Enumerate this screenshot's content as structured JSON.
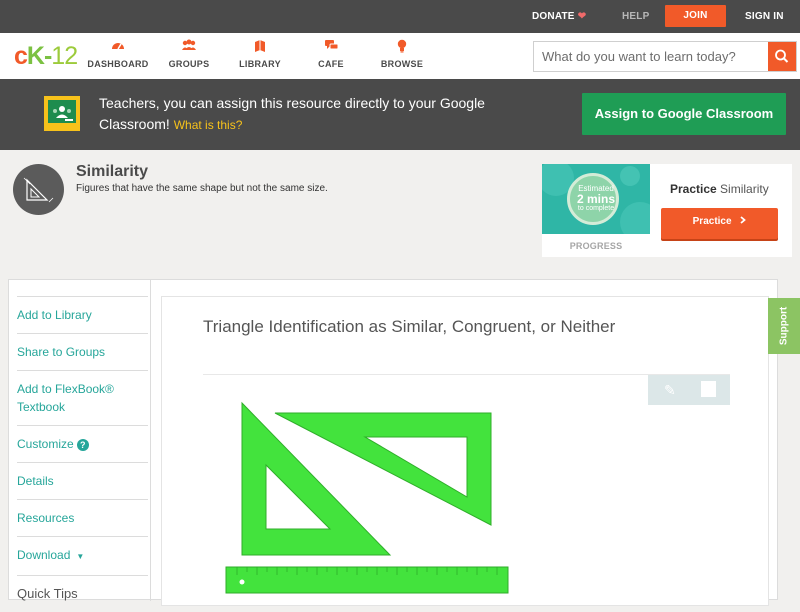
{
  "topbar": {
    "donate": "DONATE",
    "help": "HELP",
    "join": "JOIN",
    "signin": "SIGN IN"
  },
  "nav": {
    "logo": {
      "c": "c",
      "k": "K",
      "dash": "-",
      "num": "12"
    },
    "items": [
      {
        "label": "DASHBOARD",
        "icon": "dashboard-icon"
      },
      {
        "label": "GROUPS",
        "icon": "groups-icon"
      },
      {
        "label": "LIBRARY",
        "icon": "library-icon"
      },
      {
        "label": "CAFE",
        "icon": "cafe-icon"
      },
      {
        "label": "BROWSE",
        "icon": "browse-icon"
      }
    ],
    "search_placeholder": "What do you want to learn today?"
  },
  "classroom": {
    "text": "Teachers, you can assign this resource directly to your Google Classroom!",
    "what": "What is this?",
    "button": "Assign to Google Classroom"
  },
  "concept": {
    "title": "Similarity",
    "subtitle": "Figures that have the same shape but not the same size."
  },
  "practice": {
    "est_line1": "Estimated",
    "est_line2": "2 mins",
    "est_line3": "to complete",
    "progress": "PROGRESS",
    "title_bold": "Practice",
    "title_rest": " Similarity",
    "button": "Practice"
  },
  "sidebar": {
    "items": [
      "Add to Library",
      "Share to Groups",
      "Add to FlexBook® Textbook",
      "Customize",
      "Details",
      "Resources",
      "Download"
    ],
    "tips": "Quick Tips"
  },
  "content": {
    "title": "Triangle Identification as Similar, Congruent, or Neither"
  },
  "support": "Support",
  "colors": {
    "brand_orange": "#f15a29",
    "brand_green": "#7bc142",
    "teal": "#26a69a",
    "dark_bar": "#4a4a4a",
    "classroom_green": "#1f9d55"
  }
}
